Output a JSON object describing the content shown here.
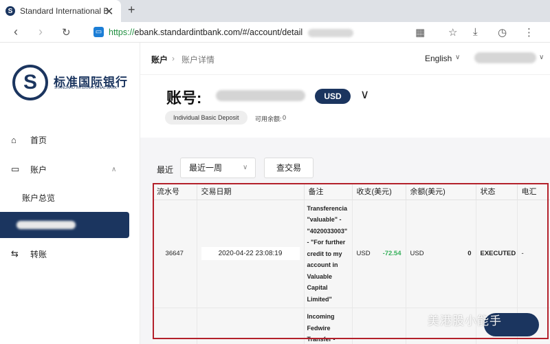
{
  "browser": {
    "tab_title": "Standard International Bank",
    "favicon_letter": "S",
    "close_glyph": "✕",
    "new_tab_glyph": "+",
    "url_protocol": "https://",
    "url_rest": "ebank.standardintbank.com/#/account/detail"
  },
  "sidebar": {
    "logo_letter": "S",
    "bank_name_cn": "标准国际银行",
    "bank_name_en": "STANDARD INTERNATIONAL BANK",
    "items": [
      {
        "label": "首页",
        "icon": "home-icon"
      },
      {
        "label": "账户",
        "icon": "card-icon"
      },
      {
        "label": "账户总览"
      },
      {
        "label": "转账",
        "icon": "transfer-icon"
      }
    ]
  },
  "header": {
    "breadcrumb": [
      "账户",
      "账户详情"
    ],
    "language": "English"
  },
  "account": {
    "label": "账号:",
    "currency": "USD",
    "type": "Individual Basic Deposit",
    "available_label": "可用余额:",
    "available_value": "0"
  },
  "filter": {
    "label": "最近",
    "selected": "最近一周",
    "query_button": "查交易"
  },
  "table": {
    "columns": [
      "流水号",
      "交易日期",
      "备注",
      "收支(美元)",
      "余额(美元)",
      "状态",
      "电汇"
    ],
    "rows": [
      {
        "serial": "36647",
        "date": "2020-04-22 23:08:19",
        "memo": "Transferencia\n\"valuable\" -\n\"4020033003\"\n- \"For further\ncredit to my\naccount in\nValuable\nCapital\nLimited\"",
        "amount_currency": "USD",
        "amount": "-72.54",
        "balance_currency": "USD",
        "balance": "0",
        "status": "EXECUTED",
        "wire": "-"
      },
      {
        "serial": "",
        "date": "",
        "memo": "Incoming\nFedwire\nTransfer -",
        "amount_currency": "",
        "amount": "",
        "balance_currency": "",
        "balance": "",
        "status": "",
        "wire": ""
      }
    ]
  },
  "watermark": "美港股小能手",
  "colors": {
    "brand_navy": "#1b355f",
    "negative_amount": "#35b05a",
    "highlight_frame": "#b3202a"
  }
}
